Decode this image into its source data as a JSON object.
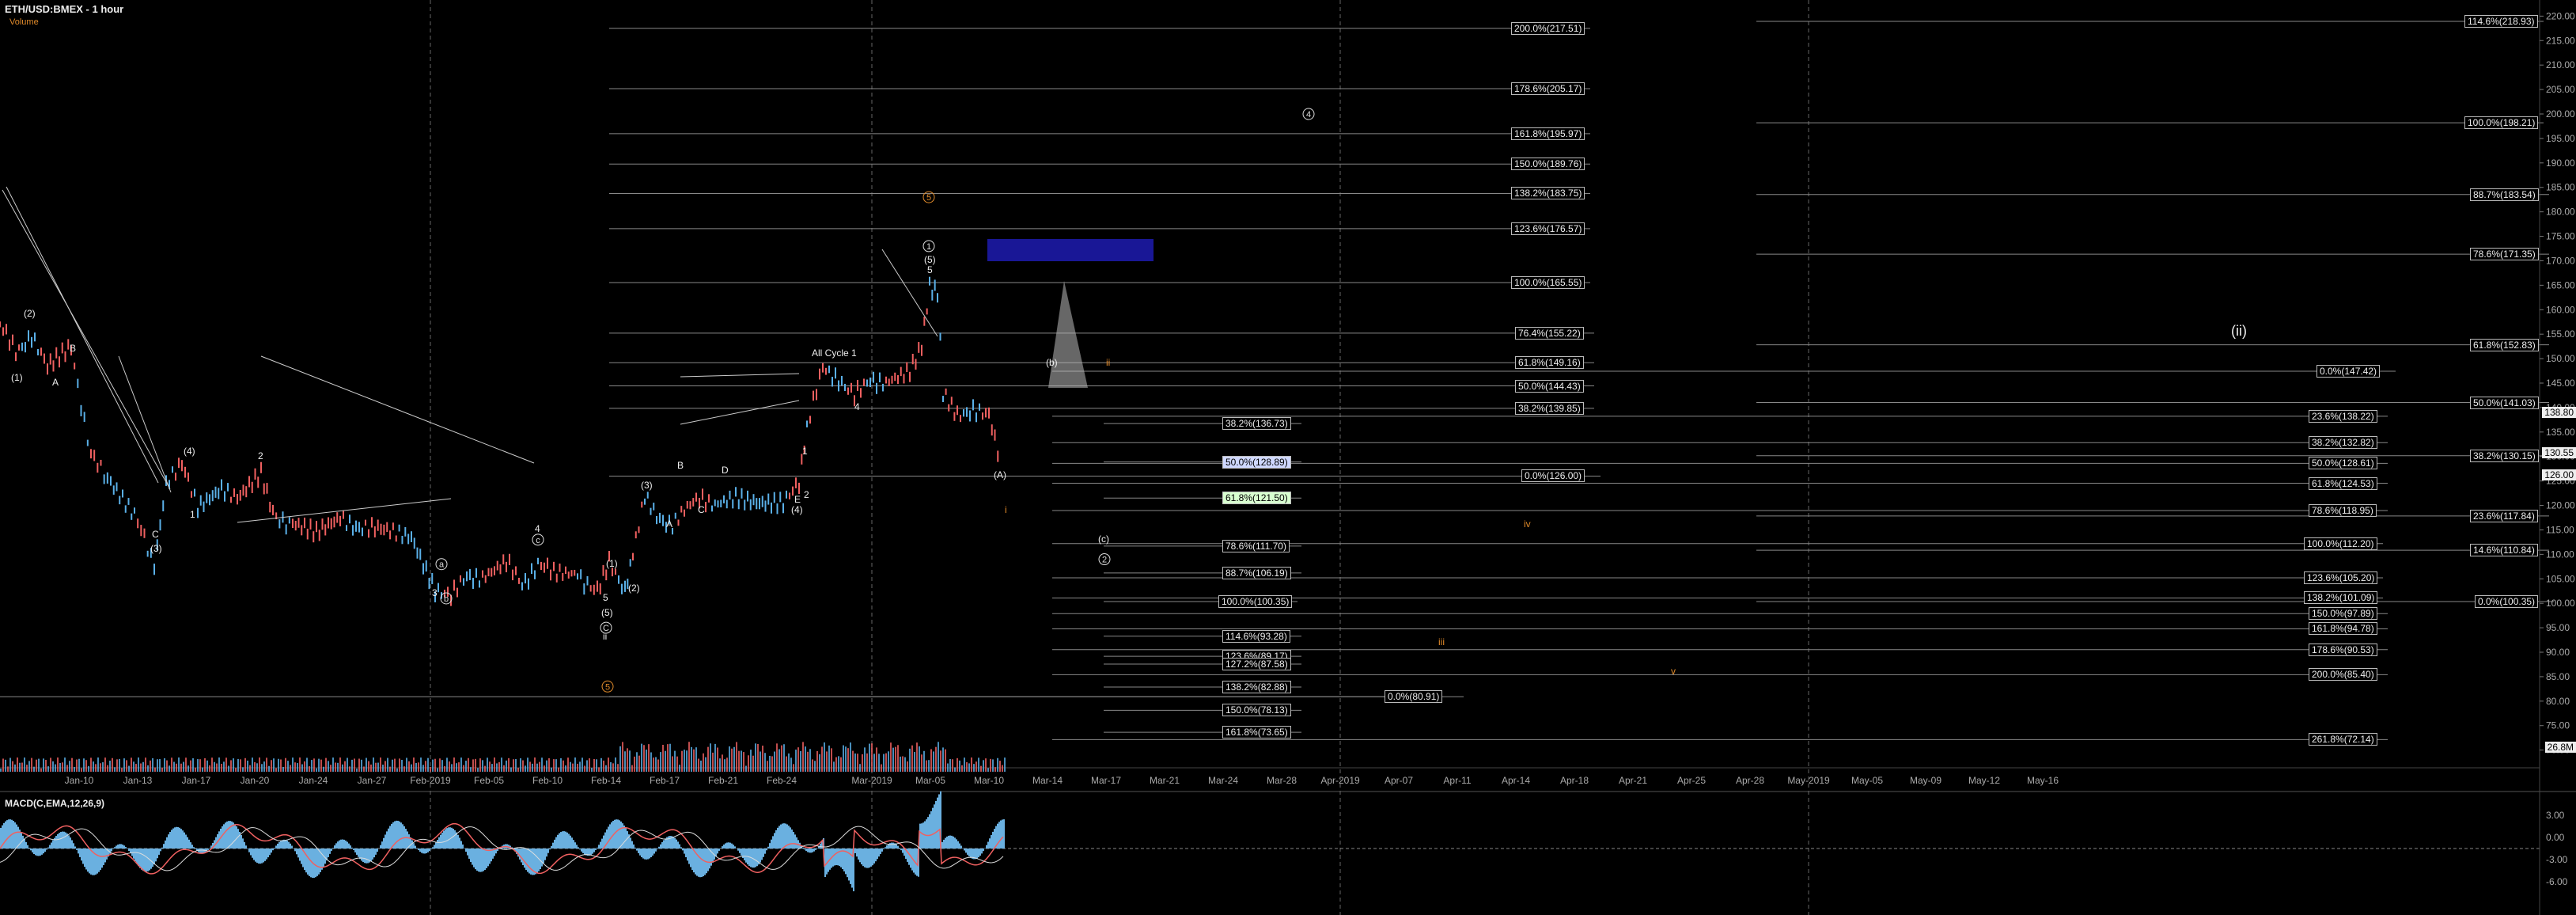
{
  "header": {
    "title": "ETH/USD:BMEX - 1 hour",
    "subtitle": "Volume"
  },
  "macd_title": "MACD(C,EMA,12,26,9)",
  "colors": {
    "background": "#000000",
    "candle_up": "#5ab0e8",
    "candle_down": "#f06060",
    "orange": "#e08a2a",
    "zone": "#1c1aa6"
  },
  "chart_data": {
    "type": "candlestick",
    "title": "ETH/USD:BMEX - 1 hour",
    "y_ticks": [
      "220.00",
      "215.00",
      "210.00",
      "205.00",
      "200.00",
      "195.00",
      "190.00",
      "185.00",
      "180.00",
      "175.00",
      "170.00",
      "165.00",
      "160.00",
      "155.00",
      "150.00",
      "145.00",
      "140.00",
      "135.00",
      "130.00",
      "125.00",
      "120.00",
      "115.00",
      "110.00",
      "105.00",
      "100.00",
      "95.00",
      "90.00",
      "85.00",
      "80.00",
      "75.00",
      "70.00"
    ],
    "ylim": [
      68,
      222
    ],
    "x_labels": [
      "Jan-10",
      "Jan-13",
      "Jan-17",
      "Jan-20",
      "Jan-24",
      "Jan-27",
      "Feb-2019",
      "Feb-05",
      "Feb-10",
      "Feb-14",
      "Feb-17",
      "Feb-21",
      "Feb-24",
      "Mar-2019",
      "Mar-05",
      "Mar-10",
      "Mar-14",
      "Mar-17",
      "Mar-21",
      "Mar-24",
      "Mar-28",
      "Apr-2019",
      "Apr-07",
      "Apr-11",
      "Apr-14",
      "Apr-18",
      "Apr-21",
      "Apr-25",
      "Apr-28",
      "May-2019",
      "May-05",
      "May-09",
      "May-12",
      "May-16"
    ],
    "price_path": [
      [
        0,
        157
      ],
      [
        20,
        151
      ],
      [
        40,
        155
      ],
      [
        60,
        148
      ],
      [
        90,
        152
      ],
      [
        115,
        130
      ],
      [
        140,
        125
      ],
      [
        170,
        118
      ],
      [
        195,
        108
      ],
      [
        210,
        125
      ],
      [
        230,
        128
      ],
      [
        250,
        120
      ],
      [
        280,
        124
      ],
      [
        300,
        121
      ],
      [
        330,
        126
      ],
      [
        345,
        118
      ],
      [
        370,
        116
      ],
      [
        400,
        114
      ],
      [
        430,
        117
      ],
      [
        470,
        115
      ],
      [
        520,
        114
      ],
      [
        550,
        103
      ],
      [
        570,
        101
      ],
      [
        590,
        106
      ],
      [
        610,
        105
      ],
      [
        640,
        108
      ],
      [
        660,
        104
      ],
      [
        680,
        108
      ],
      [
        700,
        106
      ],
      [
        730,
        106
      ],
      [
        755,
        102
      ],
      [
        770,
        108
      ],
      [
        790,
        103
      ],
      [
        800,
        110
      ],
      [
        815,
        122
      ],
      [
        830,
        118
      ],
      [
        850,
        116
      ],
      [
        865,
        119
      ],
      [
        880,
        121
      ],
      [
        900,
        120
      ],
      [
        930,
        122
      ],
      [
        960,
        121
      ],
      [
        990,
        121
      ],
      [
        1010,
        124
      ],
      [
        1020,
        136
      ],
      [
        1040,
        148
      ],
      [
        1060,
        146
      ],
      [
        1080,
        142
      ],
      [
        1100,
        146
      ],
      [
        1120,
        145
      ],
      [
        1150,
        147
      ],
      [
        1165,
        152
      ],
      [
        1175,
        165
      ],
      [
        1185,
        164
      ],
      [
        1192,
        143
      ],
      [
        1210,
        138
      ],
      [
        1230,
        140
      ],
      [
        1250,
        138
      ],
      [
        1265,
        128
      ]
    ],
    "current_price": "126.00",
    "price_labels": [
      {
        "text": "138.80",
        "y": 138.8
      },
      {
        "text": "130.55",
        "y": 130.55
      },
      {
        "text": "126.00",
        "y": 126.0
      },
      {
        "text": "26.8M",
        "y": 70.4
      }
    ],
    "fib_levels": [
      {
        "text": "200.0%(217.51)",
        "x": 1910,
        "y": 217.51
      },
      {
        "text": "178.6%(205.17)",
        "x": 1910,
        "y": 205.17
      },
      {
        "text": "161.8%(195.97)",
        "x": 1910,
        "y": 195.97
      },
      {
        "text": "150.0%(189.76)",
        "x": 1910,
        "y": 189.76
      },
      {
        "text": "138.2%(183.75)",
        "x": 1910,
        "y": 183.75
      },
      {
        "text": "123.6%(176.57)",
        "x": 1910,
        "y": 176.57
      },
      {
        "text": "100.0%(165.55)",
        "x": 1910,
        "y": 165.55
      },
      {
        "text": "76.4%(155.22)",
        "x": 1915,
        "y": 155.22
      },
      {
        "text": "61.8%(149.16)",
        "x": 1915,
        "y": 149.16
      },
      {
        "text": "50.0%(144.43)",
        "x": 1915,
        "y": 144.43
      },
      {
        "text": "38.2%(139.85)",
        "x": 1915,
        "y": 139.85
      },
      {
        "text": "0.0%(126.00)",
        "x": 1923,
        "y": 126.0
      },
      {
        "text": "38.2%(136.73)",
        "x": 1545,
        "y": 136.73
      },
      {
        "text": "50.0%(128.89)",
        "x": 1545,
        "y": 128.89,
        "hl": "blue"
      },
      {
        "text": "61.8%(121.50)",
        "x": 1545,
        "y": 121.5,
        "hl": "green"
      },
      {
        "text": "78.6%(111.70)",
        "x": 1545,
        "y": 111.7
      },
      {
        "text": "88.7%(106.19)",
        "x": 1545,
        "y": 106.19
      },
      {
        "text": "100.0%(100.35)",
        "x": 1540,
        "y": 100.35
      },
      {
        "text": "114.6%(93.28)",
        "x": 1545,
        "y": 93.28
      },
      {
        "text": "123.6%(89.17)",
        "x": 1545,
        "y": 89.17
      },
      {
        "text": "127.2%(87.58)",
        "x": 1545,
        "y": 87.58
      },
      {
        "text": "138.2%(82.88)",
        "x": 1545,
        "y": 82.88
      },
      {
        "text": "150.0%(78.13)",
        "x": 1545,
        "y": 78.13
      },
      {
        "text": "161.8%(73.65)",
        "x": 1545,
        "y": 73.65
      },
      {
        "text": "0.0%(80.91)",
        "x": 1750,
        "y": 80.91
      },
      {
        "text": "0.0%(147.42)",
        "x": 2928,
        "y": 147.42
      },
      {
        "text": "23.6%(138.22)",
        "x": 2918,
        "y": 138.22
      },
      {
        "text": "38.2%(132.82)",
        "x": 2918,
        "y": 132.82
      },
      {
        "text": "50.0%(128.61)",
        "x": 2918,
        "y": 128.61
      },
      {
        "text": "61.8%(124.53)",
        "x": 2918,
        "y": 124.53
      },
      {
        "text": "78.6%(118.95)",
        "x": 2918,
        "y": 118.95
      },
      {
        "text": "100.0%(112.20)",
        "x": 2912,
        "y": 112.2
      },
      {
        "text": "123.6%(105.20)",
        "x": 2912,
        "y": 105.2
      },
      {
        "text": "138.2%(101.09)",
        "x": 2912,
        "y": 101.09
      },
      {
        "text": "150.0%(97.89)",
        "x": 2918,
        "y": 97.89
      },
      {
        "text": "161.8%(94.78)",
        "x": 2918,
        "y": 94.78
      },
      {
        "text": "178.6%(90.53)",
        "x": 2918,
        "y": 90.53
      },
      {
        "text": "200.0%(85.40)",
        "x": 2918,
        "y": 85.4
      },
      {
        "text": "261.8%(72.14)",
        "x": 2918,
        "y": 72.14
      },
      {
        "text": "114.6%(218.93)",
        "x": 3115,
        "y": 218.93
      },
      {
        "text": "100.0%(198.21)",
        "x": 3115,
        "y": 198.21
      },
      {
        "text": "88.7%(183.54)",
        "x": 3122,
        "y": 183.54
      },
      {
        "text": "78.6%(171.35)",
        "x": 3122,
        "y": 171.35
      },
      {
        "text": "61.8%(152.83)",
        "x": 3122,
        "y": 152.83
      },
      {
        "text": "50.0%(141.03)",
        "x": 3122,
        "y": 141.03
      },
      {
        "text": "38.2%(130.15)",
        "x": 3122,
        "y": 130.15
      },
      {
        "text": "23.6%(117.84)",
        "x": 3122,
        "y": 117.84
      },
      {
        "text": "14.6%(110.84)",
        "x": 3122,
        "y": 110.84
      },
      {
        "text": "0.0%(100.35)",
        "x": 3128,
        "y": 100.35
      }
    ],
    "waves": [
      {
        "t": "(2)",
        "x": 30,
        "y": 159
      },
      {
        "t": "(1)",
        "x": 14,
        "y": 146
      },
      {
        "t": "B",
        "x": 88,
        "y": 152
      },
      {
        "t": "A",
        "x": 66,
        "y": 145
      },
      {
        "t": "(4)",
        "x": 232,
        "y": 131
      },
      {
        "t": "C",
        "x": 192,
        "y": 114
      },
      {
        "t": "(3)",
        "x": 190,
        "y": 111
      },
      {
        "t": "1",
        "x": 240,
        "y": 118
      },
      {
        "t": "2",
        "x": 326,
        "y": 130
      },
      {
        "t": "4",
        "x": 676,
        "y": 115
      },
      {
        "t": "3",
        "x": 546,
        "y": 102
      },
      {
        "t": "5",
        "x": 762,
        "y": 101
      },
      {
        "t": "(1)",
        "x": 766,
        "y": 108
      },
      {
        "t": "(2)",
        "x": 794,
        "y": 103
      },
      {
        "t": "(3)",
        "x": 810,
        "y": 124
      },
      {
        "t": "A",
        "x": 842,
        "y": 116
      },
      {
        "t": "B",
        "x": 856,
        "y": 128
      },
      {
        "t": "C",
        "x": 882,
        "y": 119
      },
      {
        "t": "D",
        "x": 912,
        "y": 127
      },
      {
        "t": "E",
        "x": 1004,
        "y": 121
      },
      {
        "t": "(4)",
        "x": 1000,
        "y": 119
      },
      {
        "t": "1",
        "x": 1014,
        "y": 131
      },
      {
        "t": "2",
        "x": 1016,
        "y": 122
      },
      {
        "t": "All Cycle 1",
        "x": 1026,
        "y": 151
      },
      {
        "t": "4",
        "x": 1080,
        "y": 140
      },
      {
        "t": "5",
        "x": 1172,
        "y": 168
      },
      {
        "t": "(5)",
        "x": 1168,
        "y": 170
      },
      {
        "t": "(A)",
        "x": 1256,
        "y": 126
      },
      {
        "t": "(b)",
        "x": 1322,
        "y": 149
      },
      {
        "t": "(c)",
        "x": 1388,
        "y": 113
      },
      {
        "t": "ii",
        "x": 1398,
        "y": 149,
        "c": "orange"
      },
      {
        "t": "i",
        "x": 1270,
        "y": 119,
        "c": "orange"
      },
      {
        "t": "iv",
        "x": 1926,
        "y": 116,
        "c": "orange"
      },
      {
        "t": "iii",
        "x": 1818,
        "y": 92,
        "c": "orange"
      },
      {
        "t": "v",
        "x": 2112,
        "y": 86,
        "c": "orange"
      },
      {
        "t": "ii",
        "x": 762,
        "y": 93
      },
      {
        "t": "(5)",
        "x": 760,
        "y": 98
      },
      {
        "t": "(ii)",
        "x": 2820,
        "y": 156,
        "big": true
      }
    ],
    "circle_waves": [
      {
        "t": "1",
        "x": 1174,
        "y": 173
      },
      {
        "t": "4",
        "x": 1654,
        "y": 200
      },
      {
        "t": "5",
        "x": 768,
        "y": 83,
        "c": "orange"
      },
      {
        "t": "c",
        "x": 680,
        "y": 113
      },
      {
        "t": "a",
        "x": 558,
        "y": 108
      },
      {
        "t": "b",
        "x": 564,
        "y": 101
      },
      {
        "t": "C",
        "x": 766,
        "y": 95
      },
      {
        "t": "2",
        "x": 1396,
        "y": 109
      },
      {
        "t": "5",
        "x": 1174,
        "y": 183,
        "c": "orange"
      }
    ]
  }
}
